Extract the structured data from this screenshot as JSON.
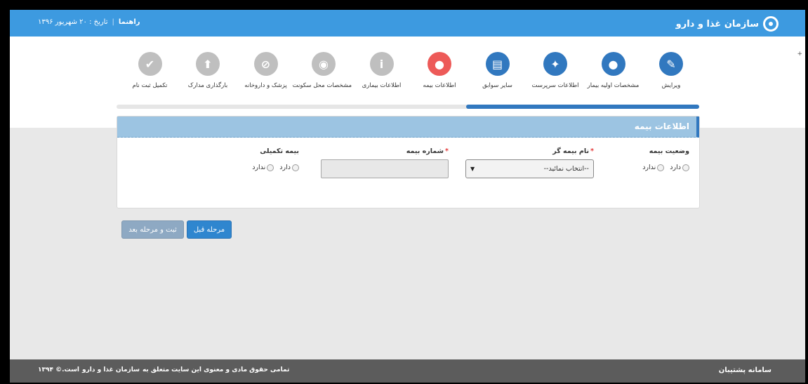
{
  "header": {
    "brand": "سازمان غذا و دارو",
    "help_link": "راهنما",
    "date_label": "تاریخ : ۲۰ شهریور ۱۳۹۶"
  },
  "steps": [
    {
      "label": "ویرایش",
      "icon": "pencil-icon",
      "glyph": "✎",
      "state": "done"
    },
    {
      "label": "مشخصات اولیه بیمار",
      "icon": "user-icon",
      "glyph": "●",
      "state": "done"
    },
    {
      "label": "اطلاعات سرپرست",
      "icon": "group-icon",
      "glyph": "✦",
      "state": "done"
    },
    {
      "label": "سایر سوابق",
      "icon": "document-icon",
      "glyph": "▤",
      "state": "done"
    },
    {
      "label": "اطلاعات بیمه",
      "icon": "user-icon",
      "glyph": "●",
      "state": "active"
    },
    {
      "label": "اطلاعات بیماری",
      "icon": "info-icon",
      "glyph": "i",
      "state": "todo"
    },
    {
      "label": "مشخصات محل سکونت",
      "icon": "map-marker-icon",
      "glyph": "◉",
      "state": "todo"
    },
    {
      "label": "پزشک و داروخانه",
      "icon": "pill-icon",
      "glyph": "⊘",
      "state": "todo"
    },
    {
      "label": "بارگذاری مدارک",
      "icon": "upload-icon",
      "glyph": "⬆",
      "state": "todo"
    },
    {
      "label": "تکمیل ثبت نام",
      "icon": "checkmark-icon",
      "glyph": "✔",
      "state": "todo"
    }
  ],
  "progress": {
    "fraction": 0.4
  },
  "panel": {
    "title": "اطلاعات بیمه",
    "insurance_status": {
      "label": "وضعیت بیمه",
      "option_yes": "دارد",
      "option_no": "ندارد"
    },
    "insurer": {
      "label": "نام بیمه گر",
      "required_mark": "*",
      "selected": "--انتخاب نمائید--"
    },
    "insurance_number": {
      "label": "شماره بیمه",
      "required_mark": "*",
      "value": ""
    },
    "supplementary": {
      "label": "بیمه تکمیلی",
      "option_yes": "دارد",
      "option_no": "ندارد"
    }
  },
  "buttons": {
    "prev": "مرحله قبل",
    "next": "ثبت و مرحله بعد"
  },
  "footer": {
    "system_name": "سامانه پشتیبان",
    "copyright_prefix": "تمامی حقوق مادی و معنوی این سایت متعلق به",
    "copyright_org": "سازمان غذا و دارو",
    "copyright_suffix": "است.© ۱۳۹۴"
  },
  "colors": {
    "header": "#3d9ae0",
    "step_done": "#3178bf",
    "step_active": "#ed5a58",
    "step_todo": "#bfbfbf",
    "footer": "#5c5c5c"
  }
}
